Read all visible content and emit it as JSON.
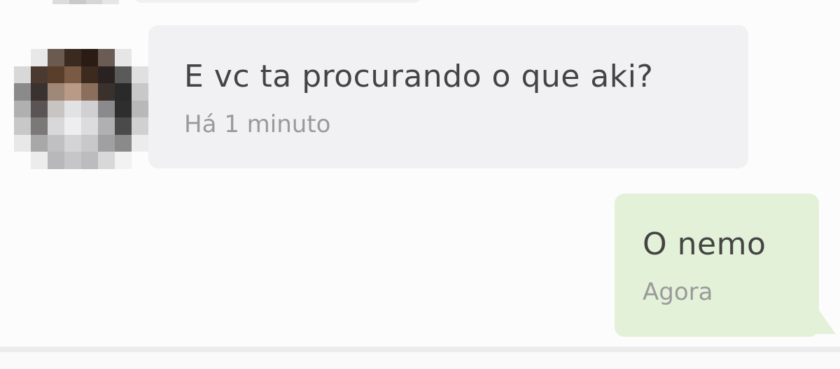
{
  "messages": [
    {
      "direction": "incoming",
      "text": "E vc ta procurando o que aki?",
      "time": "Há 1 minuto",
      "bubble_color": "#f1f1f3"
    },
    {
      "direction": "outgoing",
      "text": "O nemo",
      "time": "Agora",
      "bubble_color": "#e3f1d9"
    }
  ],
  "colors": {
    "message_text": "#444444",
    "timestamp_text": "#9a9a9a",
    "background": "#fcfcfc"
  },
  "avatar": {
    "description_icon": "pixelated-avatar-icon"
  }
}
